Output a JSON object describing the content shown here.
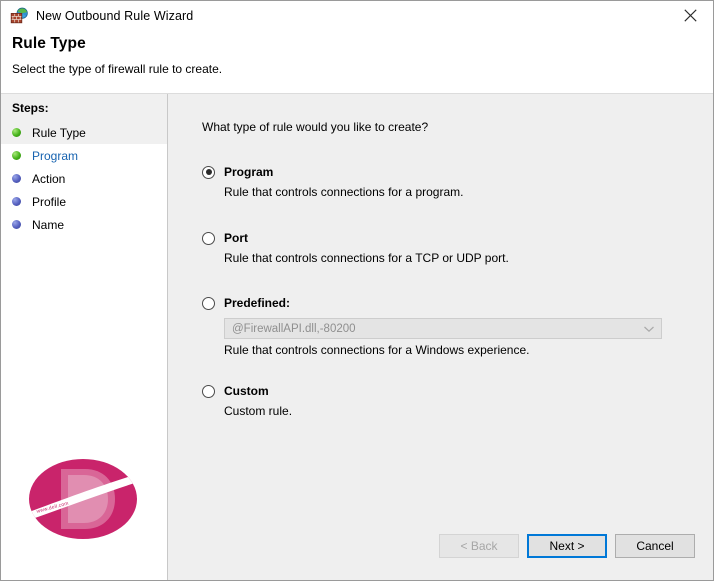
{
  "window": {
    "title": "New Outbound Rule Wizard",
    "title_icon": "firewall-icon",
    "close_icon": "close-icon"
  },
  "header": {
    "title": "Rule Type",
    "subtitle": "Select the type of firewall rule to create."
  },
  "sidebar": {
    "heading": "Steps:",
    "items": [
      {
        "label": "Rule Type",
        "bullet": "green",
        "state": "current"
      },
      {
        "label": "Program",
        "bullet": "green",
        "state": "link"
      },
      {
        "label": "Action",
        "bullet": "blue",
        "state": "pending"
      },
      {
        "label": "Profile",
        "bullet": "blue",
        "state": "pending"
      },
      {
        "label": "Name",
        "bullet": "blue",
        "state": "pending"
      }
    ]
  },
  "main": {
    "question": "What type of rule would you like to create?",
    "options": [
      {
        "label": "Program",
        "description": "Rule that controls connections for a program.",
        "selected": true
      },
      {
        "label": "Port",
        "description": "Rule that controls connections for a TCP or UDP port.",
        "selected": false
      },
      {
        "label": "Predefined:",
        "description": "Rule that controls connections for a Windows experience.",
        "selected": false,
        "combo_value": "@FirewallAPI.dll,-80200",
        "combo_icon": "chevron-down-icon",
        "combo_disabled": true
      },
      {
        "label": "Custom",
        "description": "Custom rule.",
        "selected": false
      }
    ]
  },
  "footer": {
    "back_label": "< Back",
    "next_label": "Next >",
    "cancel_label": "Cancel"
  },
  "watermark": {
    "letter": "D",
    "color": "#c9246b"
  }
}
